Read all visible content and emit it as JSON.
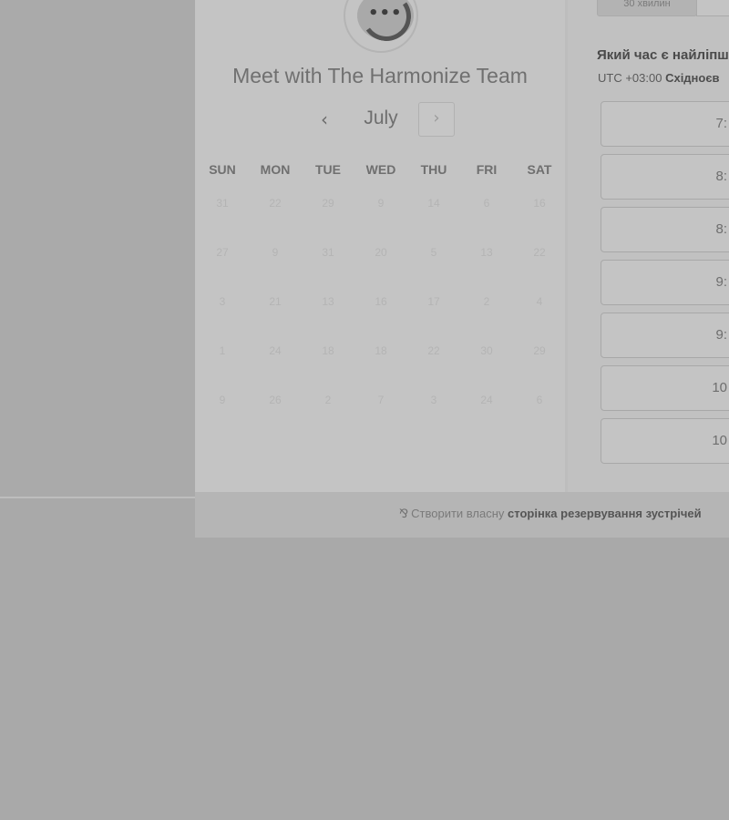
{
  "header": {
    "title": "Meet with The Harmonize Team",
    "avatar_icon": "chat-dots-icon",
    "avatar_dots": "•••"
  },
  "calendar": {
    "month": "July",
    "prev_icon": "‹",
    "next_icon": "›",
    "weekdays": [
      "SUN",
      "MON",
      "TUE",
      "WED",
      "THU",
      "FRI",
      "SAT"
    ],
    "weeks": [
      [
        "31",
        "22",
        "29",
        "9",
        "14",
        "6",
        "16"
      ],
      [
        "27",
        "9",
        "31",
        "20",
        "5",
        "13",
        "22"
      ],
      [
        "3",
        "21",
        "13",
        "16",
        "17",
        "2",
        "4"
      ],
      [
        "1",
        "24",
        "18",
        "18",
        "22",
        "30",
        "29"
      ],
      [
        "9",
        "26",
        "2",
        "7",
        "3",
        "24",
        "6"
      ]
    ]
  },
  "booking": {
    "duration_tab": "30 хвилин",
    "question": "Який час є найліпш",
    "timezone_offset": "UTC +03:00",
    "timezone_name": "Східноєв",
    "slots": [
      "7:",
      "8:",
      "8:",
      "9:",
      "9:",
      "10",
      "10"
    ]
  },
  "footer": {
    "icon": "⅋",
    "prefix": "Створити власну",
    "link": "сторінка резервування зустрічей"
  },
  "colors": {
    "backdrop": "#a9a9a9",
    "panel": "#c4c4c4",
    "accent_ring": "#545454"
  }
}
